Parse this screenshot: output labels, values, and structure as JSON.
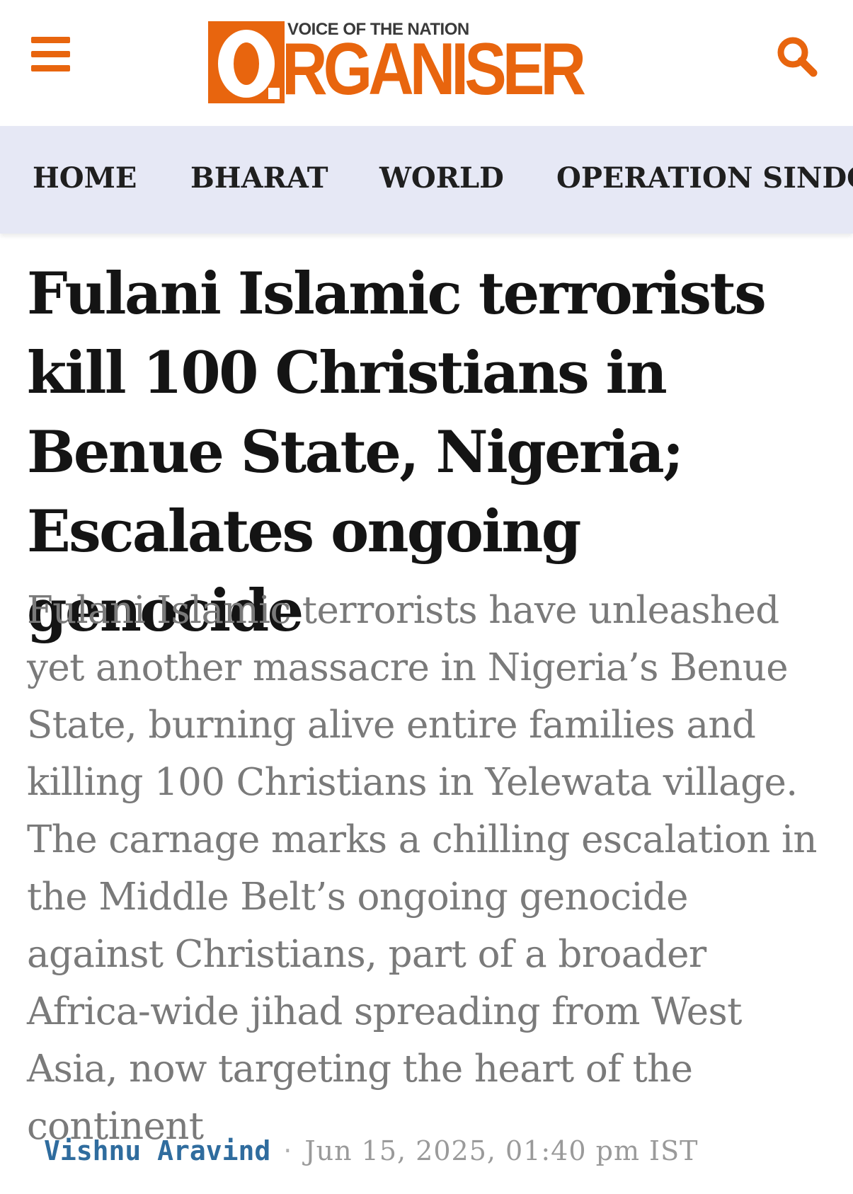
{
  "header": {
    "menu_icon": "hamburger-menu-icon",
    "logo": {
      "tagline": "VOICE OF THE NATION",
      "wordmark": "RGANISER",
      "brand_color": "#e8650e"
    },
    "search_icon": "search-icon"
  },
  "nav": {
    "items": [
      {
        "label": "HOME"
      },
      {
        "label": "BHARAT"
      },
      {
        "label": "WORLD"
      },
      {
        "label": "OPERATION SINDOOR"
      }
    ],
    "background": "#e6e8f5"
  },
  "article": {
    "headline": "Fulani Islamic terrorists kill 100 Christians in Benue State, Nigeria; Escalates ongoing genocide",
    "summary": "Fulani Islamic terrorists have unleashed yet another massacre in Nigeria’s Benue State, burning alive entire families and killing 100 Christians in Yelewata village. The carnage marks a chilling escalation in the Middle Belt’s ongoing genocide against Christians, part of a broader Africa-wide jihad spreading from West Asia, now targeting the heart of the continent",
    "author": "Vishnu Aravind",
    "separator": "·",
    "date": "Jun 15, 2025, 01:40 pm IST",
    "author_color": "#2f6c9e"
  }
}
